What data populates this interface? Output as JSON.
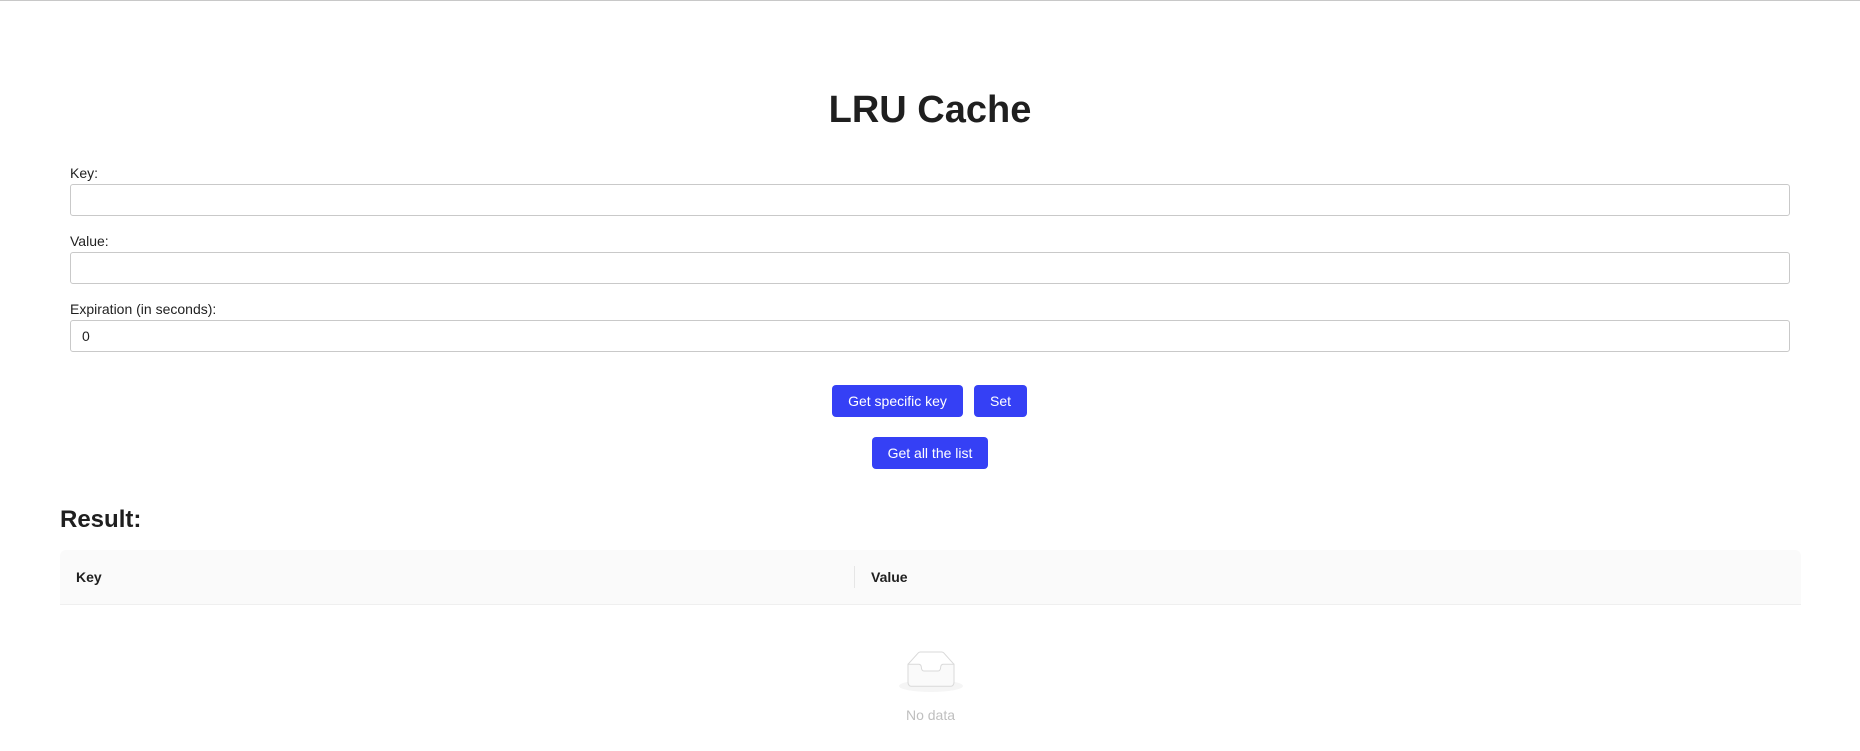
{
  "page": {
    "title": "LRU Cache"
  },
  "form": {
    "key": {
      "label": "Key:",
      "value": ""
    },
    "value": {
      "label": "Value:",
      "value": ""
    },
    "expiration": {
      "label": "Expiration (in seconds):",
      "value": "0"
    }
  },
  "actions": {
    "get_specific_key": "Get specific key",
    "set": "Set",
    "get_all": "Get all the list"
  },
  "result": {
    "heading": "Result:",
    "columns": [
      "Key",
      "Value"
    ],
    "empty_text": "No data",
    "empty_icon": "inbox-icon"
  },
  "colors": {
    "primary": "#3540f5",
    "empty_text": "#bfbfbf"
  }
}
